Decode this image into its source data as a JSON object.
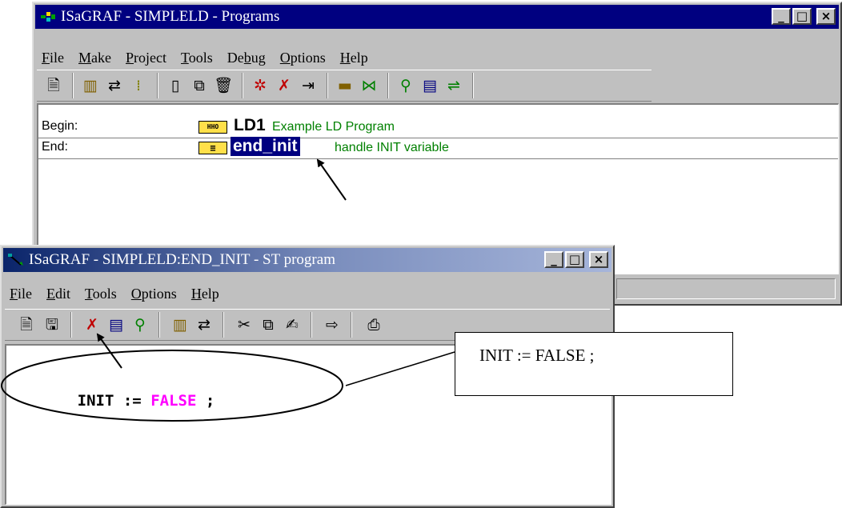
{
  "programs_window": {
    "title": "ISaGRAF - SIMPLELD - Programs",
    "icon": "isagraf-app-icon",
    "minimize": "_",
    "maximize": "□",
    "close": "×",
    "menu": [
      {
        "key": "F",
        "rest": "ile"
      },
      {
        "key": "M",
        "rest": "ake"
      },
      {
        "key": "P",
        "rest": "roject"
      },
      {
        "key": "T",
        "rest": "ools"
      },
      {
        "pre": "De",
        "key": "b",
        "rest": "ug"
      },
      {
        "key": "O",
        "rest": "ptions"
      },
      {
        "key": "H",
        "rest": "elp"
      }
    ],
    "toolbar_icons": [
      "new-document-icon",
      "dictionary-icon",
      "conversion-icon",
      "io-connection-icon",
      "new-program-icon",
      "copy-program-icon",
      "delete-icon",
      "make-icon",
      "verify-icon",
      "run-icon",
      "compile-icon",
      "debug-icon",
      "link-icon",
      "simulate-icon",
      "monitor-icon",
      "network-icon"
    ],
    "rows": [
      {
        "label": "Begin:",
        "program": "LD1",
        "program_icon": "ladder-diagram-icon",
        "icon_text": "HHO",
        "description": "Example LD Program"
      },
      {
        "label": "End:",
        "program": "end_init",
        "program_icon": "st-program-icon",
        "icon_text": "≡",
        "description": "handle INIT variable"
      }
    ]
  },
  "st_window": {
    "title": "ISaGRAF - SIMPLELD:END_INIT - ST program",
    "icon": "st-editor-icon",
    "minimize": "_",
    "maximize": "□",
    "close": "×",
    "menu": [
      {
        "key": "F",
        "rest": "ile"
      },
      {
        "key": "E",
        "rest": "dit"
      },
      {
        "key": "T",
        "rest": "ools"
      },
      {
        "key": "O",
        "rest": "ptions"
      },
      {
        "key": "H",
        "rest": "elp"
      }
    ],
    "toolbar_icons": [
      "new-icon",
      "save-icon",
      "verify-icon",
      "monitor-icon",
      "debug-icon",
      "dictionary-icon",
      "conversion-icon",
      "cut-icon",
      "copy-icon",
      "paste-icon",
      "insert-icon",
      "print-icon"
    ],
    "code": {
      "var": "INIT",
      "op": ":=",
      "value": "FALSE",
      "end": ";"
    }
  },
  "callout": {
    "text": "INIT := FALSE ;"
  }
}
